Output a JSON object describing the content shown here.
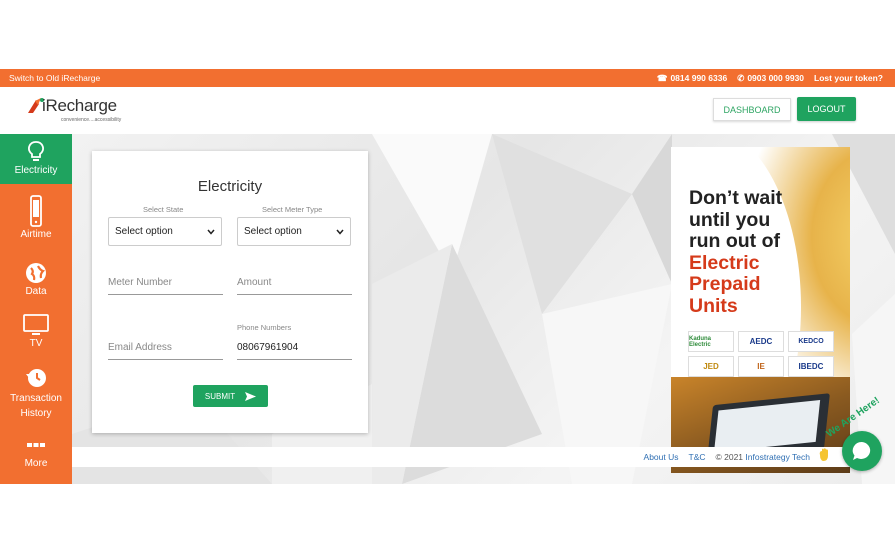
{
  "topbar": {
    "switch_label": "Switch to Old iRecharge",
    "phone_1": "0814 990 6336",
    "phone_2": "0903 000 9930",
    "lost_token": "Lost your token?"
  },
  "header": {
    "logo_text": "iRecharge",
    "logo_tagline": "convenience....accessibility",
    "dashboard_label": "DASHBOARD",
    "logout_label": "LOGOUT"
  },
  "sidebar": {
    "items": [
      {
        "label": "Electricity",
        "icon": "lightbulb-icon",
        "active": true
      },
      {
        "label": "Airtime",
        "icon": "mobile-phone-icon"
      },
      {
        "label": "Data",
        "icon": "globe-icon"
      },
      {
        "label": "TV",
        "icon": "tv-icon"
      },
      {
        "label": "Transaction History",
        "icon": "history-icon"
      },
      {
        "label": "More",
        "icon": "more-dots-icon"
      }
    ]
  },
  "form": {
    "title": "Electricity",
    "state_label": "Select State",
    "state_value": "Select option",
    "meter_type_label": "Select Meter Type",
    "meter_type_value": "Select option",
    "meter_number_placeholder": "Meter Number",
    "amount_placeholder": "Amount",
    "email_placeholder": "Email Address",
    "phone_label": "Phone Numbers",
    "phone_value": "08067961904",
    "submit_label": "SUBMIT"
  },
  "ad": {
    "line1": "Don’t wait",
    "line2": "until you",
    "line3": "run out of",
    "line4": "Electric",
    "line5": "Prepaid",
    "line6": "Units",
    "logos": [
      "Kaduna Electric",
      "AEDC",
      "KEDCO",
      "JED",
      "IE",
      "IBEDC"
    ]
  },
  "footer": {
    "about": "About Us",
    "tc": "T&C",
    "copyright": "© 2021",
    "company": "Infostrategy Tech"
  },
  "chat": {
    "tag": "We Are Here!"
  },
  "colors": {
    "orange": "#f26f30",
    "green": "#1fa35f",
    "red": "#d53a1a"
  }
}
